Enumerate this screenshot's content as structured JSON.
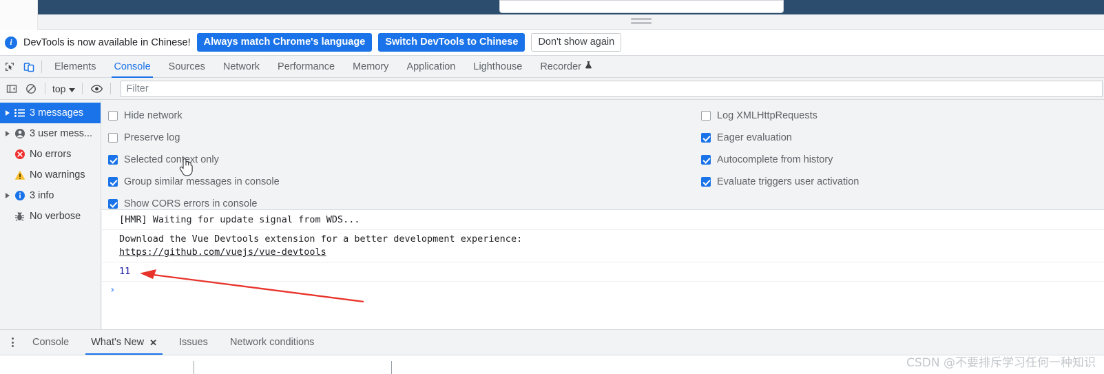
{
  "page": {
    "strip_color": "#2d4d6e",
    "input_value": ""
  },
  "banner": {
    "icon": "info-circle-icon",
    "text": "DevTools is now available in Chinese!",
    "always_match_label": "Always match Chrome's language",
    "switch_label": "Switch DevTools to Chinese",
    "dismiss_label": "Don't show again",
    "accent": "#1a73e8"
  },
  "tabbar": {
    "inspect_icon": "inspect-element-icon",
    "device_icon": "device-toolbar-icon",
    "tabs": [
      {
        "label": "Elements",
        "active": false
      },
      {
        "label": "Console",
        "active": true
      },
      {
        "label": "Sources",
        "active": false
      },
      {
        "label": "Network",
        "active": false
      },
      {
        "label": "Performance",
        "active": false
      },
      {
        "label": "Memory",
        "active": false
      },
      {
        "label": "Application",
        "active": false
      },
      {
        "label": "Lighthouse",
        "active": false
      },
      {
        "label": "Recorder",
        "active": false,
        "icon": "flask-icon"
      }
    ]
  },
  "console_toolbar": {
    "sidebar_toggle_icon": "show-console-sidebar-icon",
    "clear_icon": "clear-console-icon",
    "context": "top",
    "context_caret": "chevron-down-icon",
    "eye_icon": "live-expression-eye-icon",
    "filter_placeholder": "Filter",
    "filter_value": ""
  },
  "settings": {
    "left": [
      {
        "label": "Hide network",
        "checked": false
      },
      {
        "label": "Preserve log",
        "checked": false
      },
      {
        "label": "Selected context only",
        "checked": true
      },
      {
        "label": "Group similar messages in console",
        "checked": true
      },
      {
        "label": "Show CORS errors in console",
        "checked": true
      }
    ],
    "right": [
      {
        "label": "Log XMLHttpRequests",
        "checked": false
      },
      {
        "label": "Eager evaluation",
        "checked": true
      },
      {
        "label": "Autocomplete from history",
        "checked": true
      },
      {
        "label": "Evaluate triggers user activation",
        "checked": true
      }
    ]
  },
  "sidebar": {
    "items": [
      {
        "label": "3 messages",
        "icon": "list-messages-icon",
        "expandable": true,
        "selected": true
      },
      {
        "label": "3 user mess...",
        "icon": "user-message-icon",
        "expandable": true,
        "selected": false
      },
      {
        "label": "No errors",
        "icon": "error-icon",
        "expandable": false,
        "selected": false
      },
      {
        "label": "No warnings",
        "icon": "warning-icon",
        "expandable": false,
        "selected": false
      },
      {
        "label": "3 info",
        "icon": "info-icon",
        "expandable": true,
        "selected": false
      },
      {
        "label": "No verbose",
        "icon": "verbose-bug-icon",
        "expandable": false,
        "selected": false
      }
    ]
  },
  "console": {
    "messages": [
      {
        "text": "[HMR] Waiting for update signal from WDS...",
        "type": "log"
      },
      {
        "text": "Download the Vue Devtools extension for a better development experience:",
        "link": "https://github.com/vuejs/vue-devtools",
        "type": "log"
      },
      {
        "text": "11",
        "type": "result"
      }
    ],
    "prompt_chevron": "›"
  },
  "drawer": {
    "menu_icon": "more-options-kebab-icon",
    "tabs": [
      {
        "label": "Console",
        "active": false,
        "closable": false
      },
      {
        "label": "What's New",
        "active": true,
        "closable": true,
        "close_icon": "close-icon"
      },
      {
        "label": "Issues",
        "active": false,
        "closable": false
      },
      {
        "label": "Network conditions",
        "active": false,
        "closable": false
      }
    ]
  },
  "annotation": {
    "arrow_color": "#e8332a",
    "cursor_icon": "hand-pointer-cursor"
  },
  "watermark": {
    "text": "CSDN @不要排斥学习任何一种知识"
  }
}
